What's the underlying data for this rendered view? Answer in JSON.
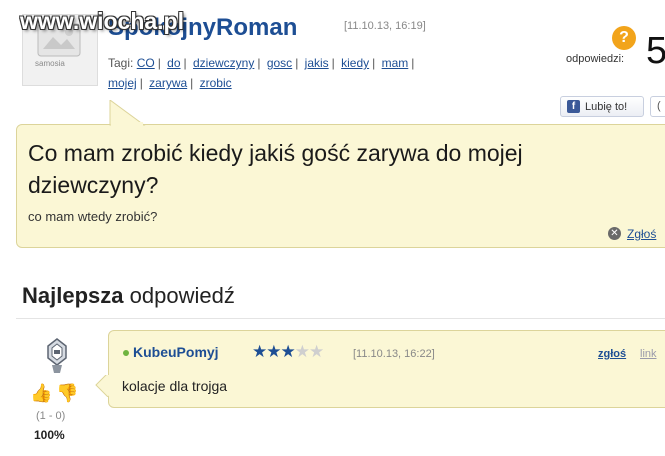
{
  "watermark": "www.wiocha.pl",
  "post": {
    "avatar_text": "samosia",
    "username": "SpokojnyRoman",
    "date": "[11.10.13, 16:19]",
    "tags_label": "Tagi:",
    "tags_line1": [
      "CO",
      "do",
      "dziewczyny",
      "gosc",
      "jakis",
      "kiedy",
      "mam"
    ],
    "tags_line2": [
      "mojej",
      "zarywa",
      "zrobic"
    ],
    "answers_label": "odpowiedzi:",
    "answers_count": "5",
    "like_label": "Lubię to!",
    "share_label": "(",
    "question_title": "Co mam zrobić kiedy jakiś gość zarywa do mojej dziewczyny?",
    "question_sub": "co mam wtedy zrobić?",
    "report_label": "Zgłoś"
  },
  "best_answer": {
    "heading_bold": "Najlepsza",
    "heading_rest": "odpowiedź",
    "author": "KubeuPomyj",
    "stars_filled": 3,
    "stars_total": 5,
    "date": "[11.10.13, 16:22]",
    "report_label": "zgłoś",
    "link_label": "link",
    "text": "kolacje dla trojga",
    "votes": "(1 - 0)",
    "percent": "100%"
  },
  "colors": {
    "accent": "#1d4e94",
    "question_bg": "#fbf7d5",
    "question_border": "#dcd49a",
    "answers_icon": "#f2a41b"
  },
  "icons": [
    "question-mark-icon",
    "facebook-icon",
    "report-icon",
    "thumbs-up-icon",
    "thumbs-down-icon",
    "star-icon",
    "online-dot-icon",
    "robot-avatar-icon"
  ]
}
